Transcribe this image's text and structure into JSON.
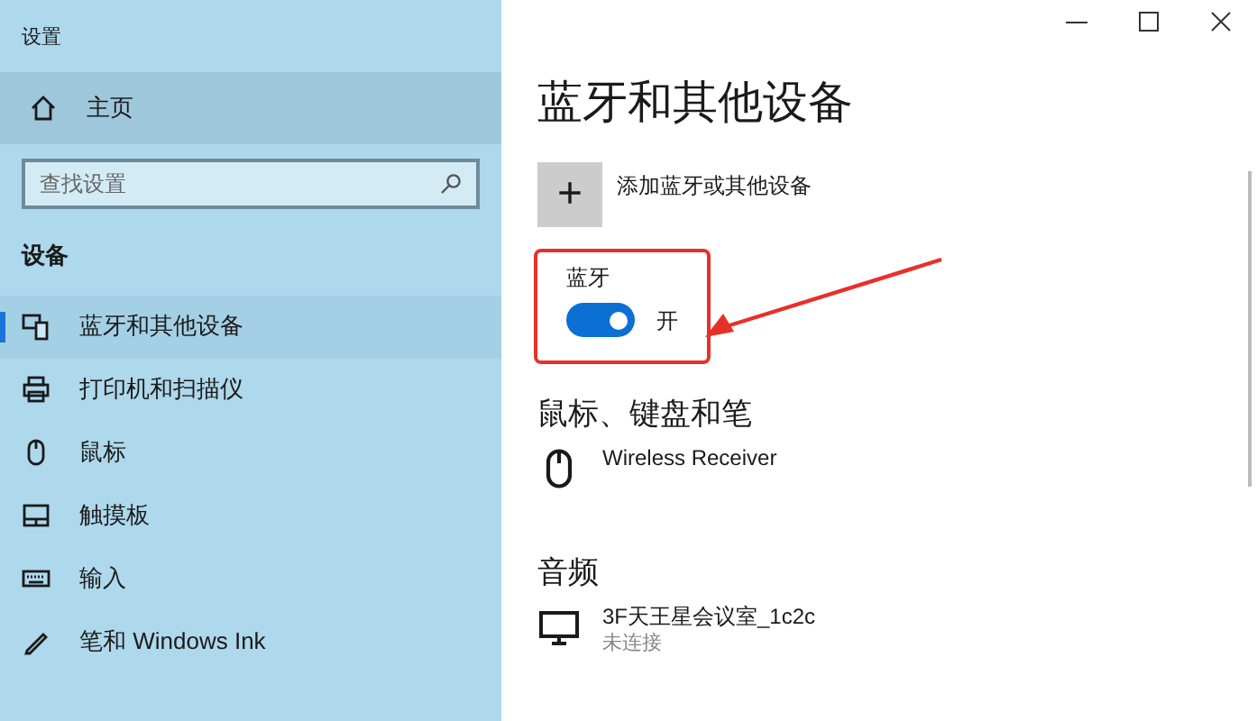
{
  "window": {
    "title": "设置"
  },
  "sidebar": {
    "home": {
      "label": "主页",
      "selected": false
    },
    "search": {
      "placeholder": "查找设置"
    },
    "section": "设备",
    "items": [
      {
        "label": "蓝牙和其他设备",
        "kind": "bluetooth",
        "selected": true
      },
      {
        "label": "打印机和扫描仪",
        "kind": "printer",
        "selected": false
      },
      {
        "label": "鼠标",
        "kind": "mouse",
        "selected": false
      },
      {
        "label": "触摸板",
        "kind": "touchpad",
        "selected": false
      },
      {
        "label": "输入",
        "kind": "keyboard",
        "selected": false
      },
      {
        "label": "笔和 Windows Ink",
        "kind": "pen",
        "selected": false
      }
    ]
  },
  "main": {
    "title": "蓝牙和其他设备",
    "add_button": {
      "icon": "+",
      "label": "添加蓝牙或其他设备"
    },
    "bluetooth": {
      "label": "蓝牙",
      "on": true,
      "state_text": "开"
    },
    "sections": [
      {
        "heading": "鼠标、键盘和笔",
        "devices": [
          {
            "kind": "mouse",
            "name": "Wireless Receiver"
          }
        ]
      },
      {
        "heading": "音频",
        "devices": [
          {
            "kind": "monitor",
            "name": "3F天王星会议室_1c2c",
            "status": "未连接"
          }
        ]
      }
    ]
  }
}
